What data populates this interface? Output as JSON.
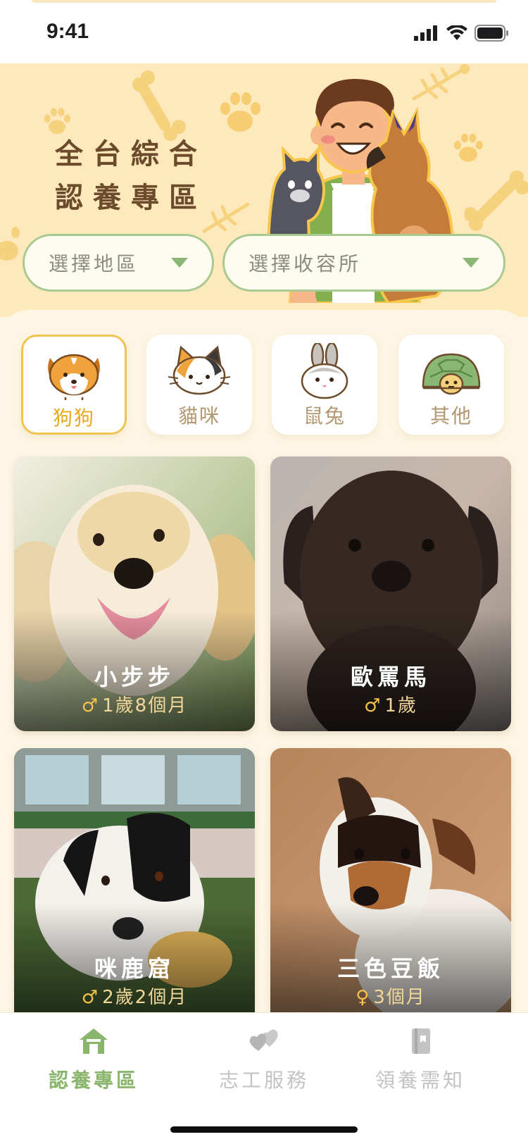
{
  "status_bar": {
    "time": "9:41"
  },
  "hero": {
    "title_line1": "全台綜合",
    "title_line2": "認養專區"
  },
  "filters": {
    "region": {
      "label": "選擇地區"
    },
    "shelter": {
      "label": "選擇收容所"
    }
  },
  "categories": [
    {
      "label": "狗狗",
      "icon": "dog-icon",
      "active": true
    },
    {
      "label": "貓咪",
      "icon": "cat-icon",
      "active": false
    },
    {
      "label": "鼠兔",
      "icon": "rabbit-icon",
      "active": false
    },
    {
      "label": "其他",
      "icon": "turtle-icon",
      "active": false
    }
  ],
  "pets": [
    {
      "name": "小步步",
      "gender_symbol": "♂",
      "age": "1歲8個月"
    },
    {
      "name": "歐罵馬",
      "gender_symbol": "♂",
      "age": "1歲"
    },
    {
      "name": "咪鹿窟",
      "gender_symbol": "♂",
      "age": "2歲2個月"
    },
    {
      "name": "三色豆飯",
      "gender_symbol": "♀",
      "age": "3個月"
    }
  ],
  "bottom_nav": [
    {
      "label": "認養專區",
      "icon": "home-icon",
      "active": true
    },
    {
      "label": "志工服務",
      "icon": "hearts-icon",
      "active": false
    },
    {
      "label": "領養需知",
      "icon": "notebook-icon",
      "active": false
    }
  ],
  "colors": {
    "accent_green": "#8ab56d",
    "accent_yellow": "#f0c44e",
    "hero_bg": "#fde9bb",
    "title_brown": "#6b4b2b"
  }
}
